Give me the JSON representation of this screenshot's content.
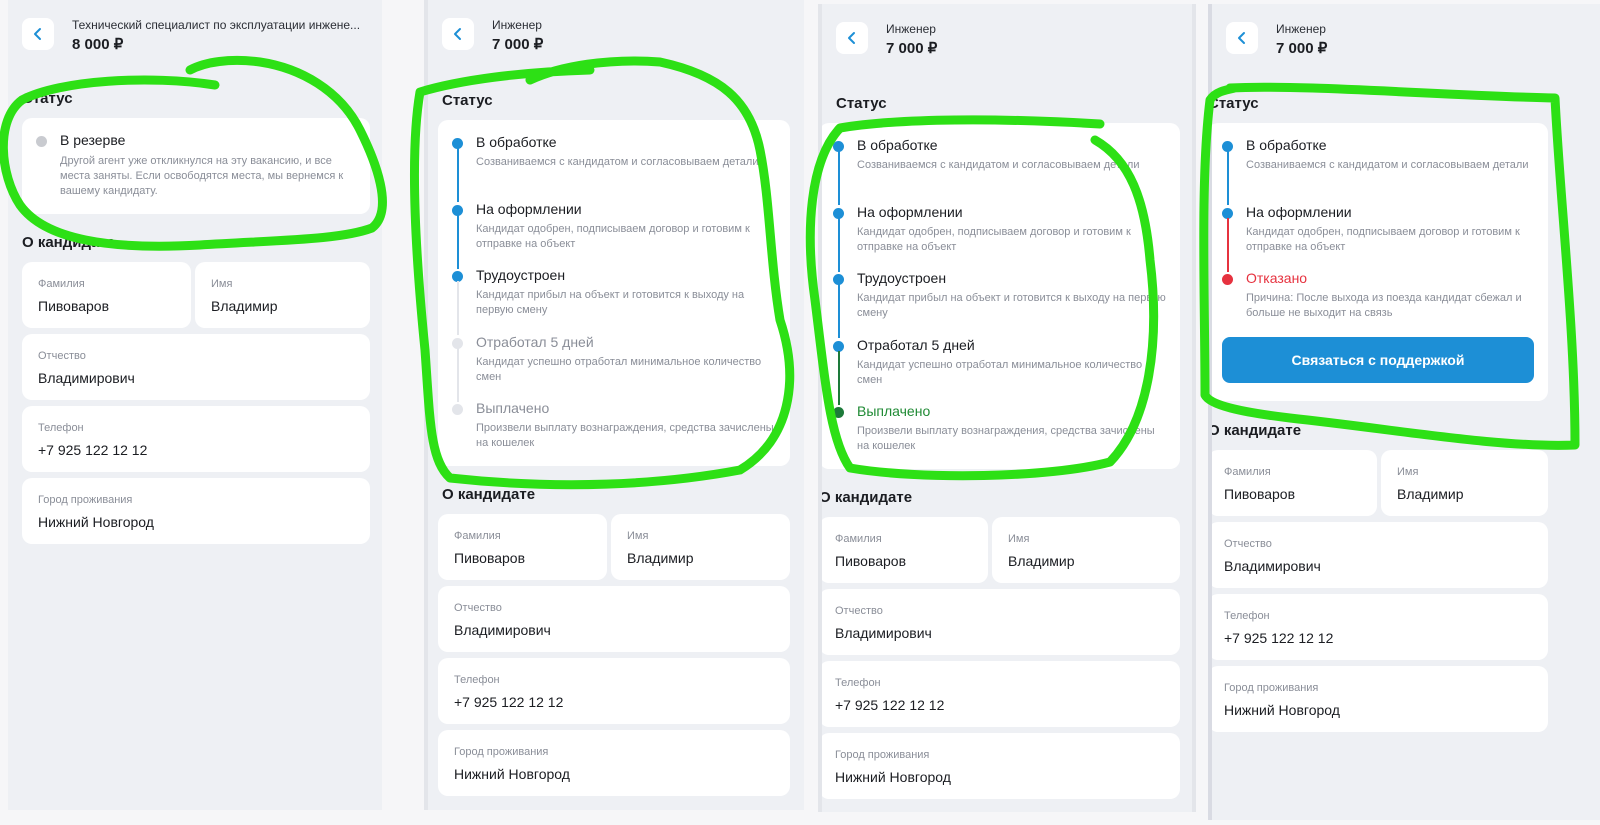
{
  "colors": {
    "accent": "#1d8fd6",
    "success": "#1f8a34",
    "danger": "#e6323f",
    "annotation": "#2de015"
  },
  "icons": {
    "back": "chevron-left-icon",
    "status_dot": "timeline-dot-icon"
  },
  "panels": [
    {
      "job_title": "Технический специалист по эксплуатации инжене...",
      "price": "8 000 ₽",
      "status_title": "Статус",
      "reserve": {
        "title": "В резерве",
        "desc": "Другой агент уже откликнулся на эту вакансию, и все места заняты. Если освободятся места, мы вернемся к вашему кандидату."
      },
      "candidate_title": "О кандидате",
      "fields": [
        {
          "label": "Фамилия",
          "value": "Пивоваров"
        },
        {
          "label": "Имя",
          "value": "Владимир"
        },
        {
          "label": "Отчество",
          "value": "Владимирович"
        },
        {
          "label": "Телефон",
          "value": "+7 925 122 12 12"
        },
        {
          "label": "Город проживания",
          "value": "Нижний Новгород"
        }
      ]
    },
    {
      "job_title": "Инженер",
      "price": "7 000 ₽",
      "status_title": "Статус",
      "steps": [
        {
          "title": "В обработке",
          "desc": "Созваниваемся с кандидатом и согласовываем детали"
        },
        {
          "title": "На оформлении",
          "desc": "Кандидат одобрен, подписываем договор и готовим к отправке на объект"
        },
        {
          "title": "Трудоустроен",
          "desc": "Кандидат прибыл на объект и готовится к выходу на первую смену"
        },
        {
          "title": "Отработал 5 дней",
          "desc": "Кандидат успешно отработал минимальное количество смен"
        },
        {
          "title": "Выплачено",
          "desc": "Произвели выплату вознаграждения, средства зачислены на кошелек"
        }
      ],
      "candidate_title": "О кандидате",
      "fields": [
        {
          "label": "Фамилия",
          "value": "Пивоваров"
        },
        {
          "label": "Имя",
          "value": "Владимир"
        },
        {
          "label": "Отчество",
          "value": "Владимирович"
        },
        {
          "label": "Телефон",
          "value": "+7 925 122 12 12"
        },
        {
          "label": "Город проживания",
          "value": "Нижний Новгород"
        }
      ]
    },
    {
      "job_title": "Инженер",
      "price": "7 000 ₽",
      "status_title": "Статус",
      "steps": [
        {
          "title": "В обработке",
          "desc": "Созваниваемся с кандидатом и согласовываем детали"
        },
        {
          "title": "На оформлении",
          "desc": "Кандидат одобрен, подписываем договор и готовим к отправке на объект"
        },
        {
          "title": "Трудоустроен",
          "desc": "Кандидат прибыл на объект и готовится к выходу на первую смену"
        },
        {
          "title": "Отработал 5 дней",
          "desc": "Кандидат успешно отработал минимальное количество смен"
        },
        {
          "title": "Выплачено",
          "desc": "Произвели выплату вознаграждения, средства зачислены на кошелек"
        }
      ],
      "candidate_title": "О кандидате",
      "fields": [
        {
          "label": "Фамилия",
          "value": "Пивоваров"
        },
        {
          "label": "Имя",
          "value": "Владимир"
        },
        {
          "label": "Отчество",
          "value": "Владимирович"
        },
        {
          "label": "Телефон",
          "value": "+7 925 122 12 12"
        },
        {
          "label": "Город проживания",
          "value": "Нижний Новгород"
        }
      ]
    },
    {
      "job_title": "Инженер",
      "price": "7 000 ₽",
      "status_title": "Статус",
      "steps": [
        {
          "title": "В обработке",
          "desc": "Созваниваемся с кандидатом и согласовываем детали"
        },
        {
          "title": "На оформлении",
          "desc": "Кандидат одобрен, подписываем договор и готовим к отправке на объект"
        },
        {
          "title": "Отказано",
          "desc": "Причина: После выхода из поезда кандидат сбежал и больше не выходит на связь"
        }
      ],
      "support_button": "Связаться с поддержкой",
      "candidate_title": "О кандидате",
      "fields": [
        {
          "label": "Фамилия",
          "value": "Пивоваров"
        },
        {
          "label": "Имя",
          "value": "Владимир"
        },
        {
          "label": "Отчество",
          "value": "Владимирович"
        },
        {
          "label": "Телефон",
          "value": "+7 925 122 12 12"
        },
        {
          "label": "Город проживания",
          "value": "Нижний Новгород"
        }
      ]
    }
  ]
}
